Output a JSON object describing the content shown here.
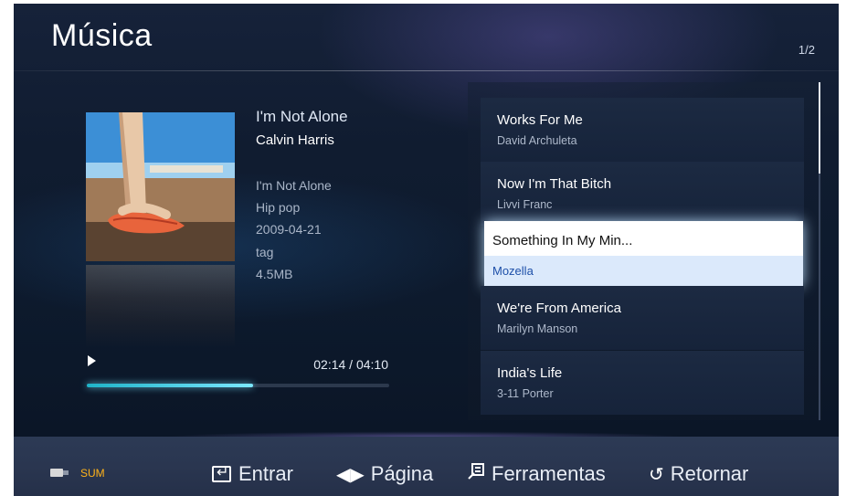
{
  "header": {
    "title": "Música",
    "page_indicator": "1/2"
  },
  "now_playing": {
    "title": "I'm Not Alone",
    "artist": "Calvin Harris",
    "album": "I'm Not Alone",
    "genre": "Hip pop",
    "date": "2009-04-21",
    "tag": "tag",
    "size": "4.5MB",
    "time": "02:14 / 04:10",
    "progress": 0.55
  },
  "playlist": {
    "items": [
      {
        "title": "Works For Me",
        "artist": "David Archuleta"
      },
      {
        "title": "Now I'm That Bitch",
        "artist": "Livvi Franc"
      },
      {
        "title": "Something In My Min...",
        "artist": "Mozella"
      },
      {
        "title": "We're From America",
        "artist": "Marilyn Manson"
      },
      {
        "title": "India's Life",
        "artist": "3-11 Porter"
      }
    ],
    "selected_index": 2
  },
  "footer": {
    "device": "SUM",
    "enter_label": "Entrar",
    "page_label": "Página",
    "tools_label": "Ferramentas",
    "return_label": "Retornar"
  },
  "icons": {
    "play": "play-icon",
    "usb": "usb-drive-icon",
    "enter": "enter-icon",
    "page": "left-right-arrows-icon",
    "tools": "tools-icon",
    "return": "return-icon"
  },
  "colors": {
    "accent_progress": "#1fb3c8",
    "selected_artist": "#1d4fa8",
    "device_label": "#ffb31a"
  }
}
